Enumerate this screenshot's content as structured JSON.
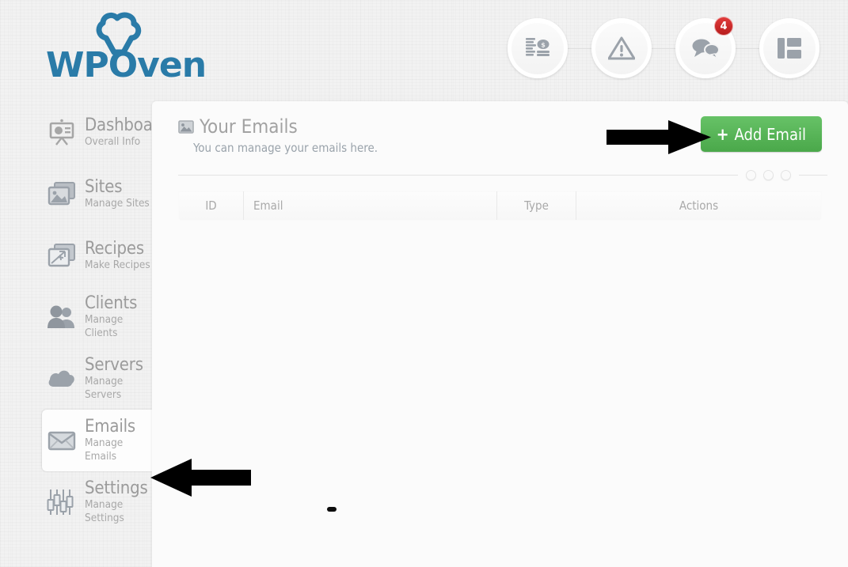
{
  "brand": {
    "wordmark": "WPOven",
    "hat_icon": "chef-hat-icon",
    "accent_color": "#2a7ba8"
  },
  "header": {
    "icons": [
      {
        "name": "billing-icon",
        "label": "Billing"
      },
      {
        "name": "alerts-icon",
        "label": "Alerts"
      },
      {
        "name": "messages-icon",
        "label": "Messages",
        "badge": "4"
      },
      {
        "name": "layout-icon",
        "label": "Layout"
      }
    ],
    "badge_color": "#c62222"
  },
  "sidebar": {
    "items": [
      {
        "icon": "dashboard-icon",
        "label": "Dashboard",
        "sub": "Overall Info",
        "active": false
      },
      {
        "icon": "sites-icon",
        "label": "Sites",
        "sub": "Manage Sites",
        "active": false
      },
      {
        "icon": "recipes-icon",
        "label": "Recipes",
        "sub": "Make Recipes",
        "active": false
      },
      {
        "icon": "clients-icon",
        "label": "Clients",
        "sub": "Manage Clients",
        "active": false
      },
      {
        "icon": "servers-icon",
        "label": "Servers",
        "sub": "Manage Servers",
        "active": false
      },
      {
        "icon": "emails-icon",
        "label": "Emails",
        "sub": "Manage Emails",
        "active": true
      },
      {
        "icon": "settings-icon",
        "label": "Settings",
        "sub": "Manage Settings",
        "active": false
      }
    ]
  },
  "main": {
    "title": "Your Emails",
    "title_icon": "image-icon",
    "subtitle": "You can manage your emails here.",
    "add_button": {
      "plus": "+",
      "label": "Add Email",
      "color": "#55b155"
    },
    "divider_dots": 3,
    "table": {
      "columns": [
        "ID",
        "Email",
        "Type",
        "Actions"
      ],
      "rows": []
    }
  },
  "annotations": [
    {
      "name": "arrow-to-add-email",
      "direction": "right"
    },
    {
      "name": "arrow-to-emails-nav",
      "direction": "left"
    }
  ]
}
